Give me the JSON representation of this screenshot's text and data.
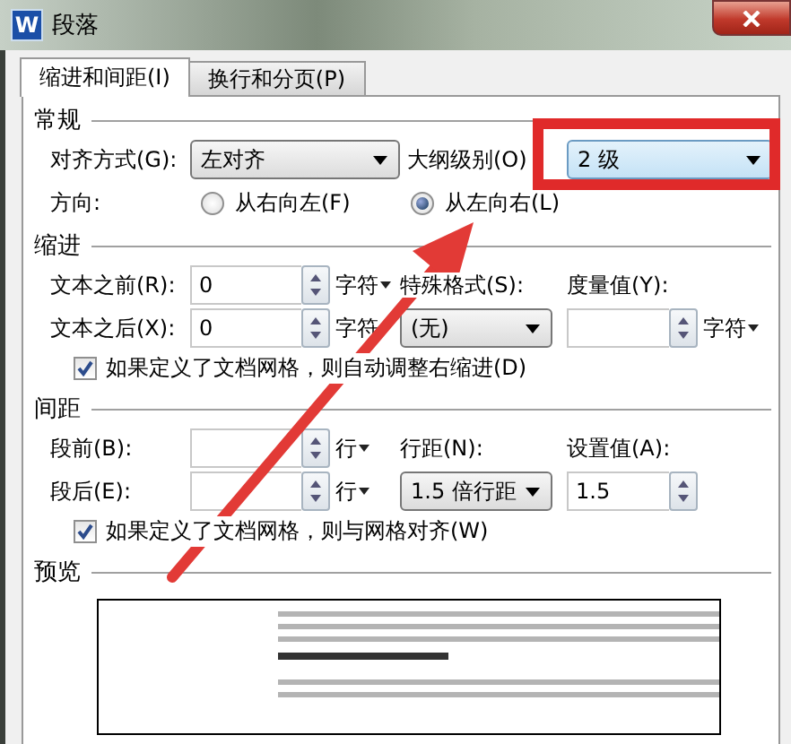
{
  "window": {
    "logo": "W",
    "title": "段落"
  },
  "tabs": [
    {
      "label": "缩进和间距(I)",
      "selected": true
    },
    {
      "label": "换行和分页(P)",
      "selected": false
    }
  ],
  "general": {
    "heading": "常规",
    "alignment": {
      "label": "对齐方式(G):",
      "value": "左对齐"
    },
    "outline_level": {
      "label": "大纲级别(O)",
      "value": "2 级"
    },
    "direction": {
      "label": "方向:",
      "options": [
        {
          "label": "从右向左(F)",
          "selected": false
        },
        {
          "label": "从左向右(L)",
          "selected": true
        }
      ]
    }
  },
  "indent": {
    "heading": "缩进",
    "before": {
      "label": "文本之前(R):",
      "value": "0",
      "unit": "字符"
    },
    "after": {
      "label": "文本之后(X):",
      "value": "0",
      "unit": "字符"
    },
    "special": {
      "label": "特殊格式(S):",
      "value": "(无)"
    },
    "measure": {
      "label": "度量值(Y):",
      "unit": "字符"
    },
    "checkbox": {
      "label": "如果定义了文档网格，则自动调整右缩进(D)",
      "checked": true
    }
  },
  "spacing": {
    "heading": "间距",
    "before": {
      "label": "段前(B):",
      "unit": "行"
    },
    "after": {
      "label": "段后(E):",
      "unit": "行"
    },
    "line_spacing": {
      "label": "行距(N):",
      "value": "1.5 倍行距"
    },
    "setting": {
      "label": "设置值(A):",
      "value": "1.5"
    },
    "checkbox": {
      "label": "如果定义了文档网格，则与网格对齐(W)",
      "checked": true
    }
  },
  "preview": {
    "heading": "预览"
  }
}
